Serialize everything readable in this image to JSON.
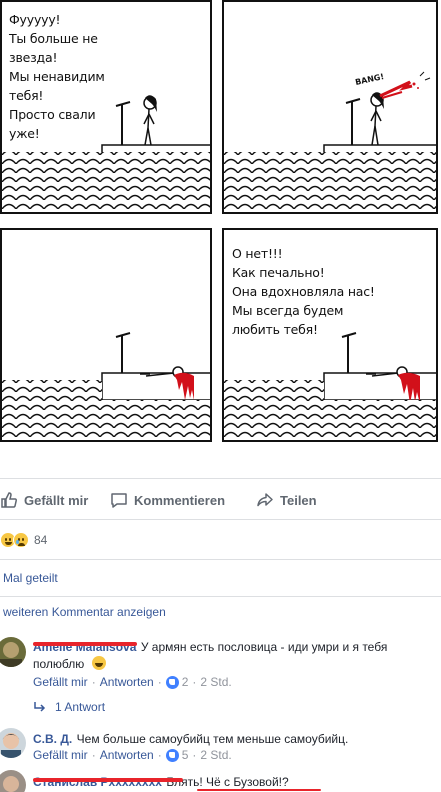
{
  "comic": {
    "panel1_lines": [
      "Фууууу!",
      "Ты больше не",
      "звезда!",
      "Мы ненавидим",
      "тебя!",
      "Просто свали",
      "уже!"
    ],
    "panel2_sound": "BANG!",
    "panel4_lines": [
      "О нет!!!",
      "Как печально!",
      "Она вдохновляла нас!",
      "Мы всегда будем",
      "любить тебя!"
    ]
  },
  "actions": {
    "like": "Gefällt mir",
    "comment": "Kommentieren",
    "share": "Teilen"
  },
  "reactions": {
    "count": "84"
  },
  "shared_text": "Mal geteilt",
  "more_comments": "weiteren Kommentar anzeigen",
  "comments": [
    {
      "name": "Amelie Malalisova",
      "text": "У армян есть пословица - иди умри и я тебя",
      "text2": "полюблю",
      "like_label": "Gefällt mir",
      "reply_label": "Antworten",
      "likes": "2",
      "time": "2 Std.",
      "replies": "1 Antwort"
    },
    {
      "name": "С.В. Д.",
      "text": "Чем больше самоубийц тем меньше самоубийц.",
      "like_label": "Gefällt mir",
      "reply_label": "Antworten",
      "likes": "5",
      "time": "2 Std."
    },
    {
      "name": "Станислав Рxxxxxxxx",
      "text": "Блять! Чё с Бузовой!?"
    }
  ],
  "colors": {
    "link": "#385898",
    "redaction": "#e8242b",
    "blood": "#d2101a",
    "meta": "#90949c"
  }
}
